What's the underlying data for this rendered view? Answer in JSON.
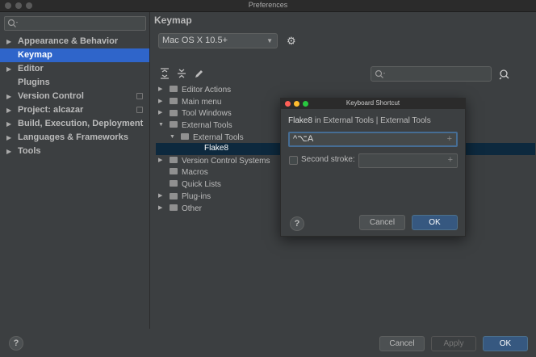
{
  "window": {
    "title": "Preferences"
  },
  "sidebar": {
    "search_placeholder": "",
    "items": [
      {
        "label": "Appearance & Behavior",
        "expandable": true,
        "selected": false
      },
      {
        "label": "Keymap",
        "expandable": false,
        "selected": true
      },
      {
        "label": "Editor",
        "expandable": true,
        "selected": false
      },
      {
        "label": "Plugins",
        "expandable": false,
        "selected": false
      },
      {
        "label": "Version Control",
        "expandable": true,
        "selected": false,
        "project_icon": true
      },
      {
        "label": "Project: alcazar",
        "expandable": true,
        "selected": false,
        "project_icon": true
      },
      {
        "label": "Build, Execution, Deployment",
        "expandable": true,
        "selected": false
      },
      {
        "label": "Languages & Frameworks",
        "expandable": true,
        "selected": false
      },
      {
        "label": "Tools",
        "expandable": true,
        "selected": false
      }
    ]
  },
  "main": {
    "heading": "Keymap",
    "keymap_selected": "Mac OS X 10.5+",
    "icons": {
      "settings": "gear-icon",
      "expand_all": "expand-all-icon",
      "collapse_all": "collapse-all-icon",
      "edit": "pencil-icon",
      "find_shortcut": "find-by-shortcut-icon"
    },
    "tree": [
      {
        "label": "Editor Actions",
        "state": "collapsed",
        "indent": 0
      },
      {
        "label": "Main menu",
        "state": "collapsed",
        "indent": 0
      },
      {
        "label": "Tool Windows",
        "state": "collapsed",
        "indent": 0
      },
      {
        "label": "External Tools",
        "state": "expanded",
        "indent": 0
      },
      {
        "label": "External Tools",
        "state": "expanded",
        "indent": 1
      },
      {
        "label": "Flake8",
        "state": "leaf",
        "indent": 2,
        "selected": true
      },
      {
        "label": "Version Control Systems",
        "state": "collapsed",
        "indent": 0
      },
      {
        "label": "Macros",
        "state": "none",
        "indent": 0
      },
      {
        "label": "Quick Lists",
        "state": "none",
        "indent": 0
      },
      {
        "label": "Plug-ins",
        "state": "collapsed",
        "indent": 0
      },
      {
        "label": "Other",
        "state": "collapsed",
        "indent": 0
      }
    ]
  },
  "dialog": {
    "title": "Keyboard Shortcut",
    "action": "Flake8",
    "path": " in External Tools | External Tools",
    "first_stroke": "^⌥A",
    "second_stroke_label": "Second stroke:",
    "second_stroke_checked": false,
    "cancel_label": "Cancel",
    "ok_label": "OK",
    "help_label": "?",
    "traffic_light_colors": [
      "#ff5f57",
      "#febc2e",
      "#28c840"
    ]
  },
  "footer": {
    "help_label": "?",
    "cancel_label": "Cancel",
    "apply_label": "Apply",
    "ok_label": "OK"
  },
  "colors": {
    "accent": "#2f65ca",
    "primary_button": "#365880",
    "selected_row": "#0d293e",
    "background": "#3c3f41"
  }
}
